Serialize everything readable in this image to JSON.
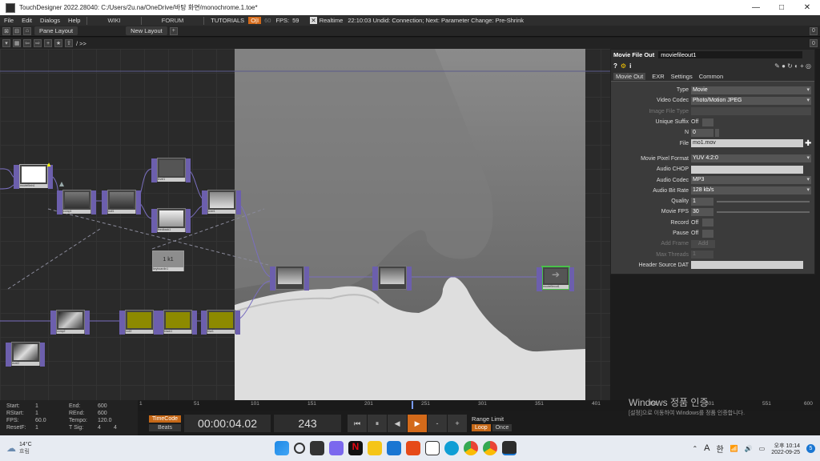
{
  "window": {
    "title": "TouchDesigner 2022.28040: C:/Users/2u.na/OneDrive/바탕 화면/monochrome.1.toe*",
    "controls": [
      "—",
      "□",
      "✕"
    ]
  },
  "menubar": {
    "items": [
      "File",
      "Edit",
      "Dialogs",
      "Help"
    ],
    "wiki": "WIKI",
    "forum": "FORUM",
    "tutorials": "TUTORIALS",
    "perf": "O|I",
    "fps_target": "60",
    "fps_label": "FPS:",
    "fps_value": "59",
    "realtime_check": "✕",
    "realtime_label": "Realtime",
    "status": "22:10:03 Undid: Connection; Next: Parameter Change: Pre-Shrink"
  },
  "panebar": {
    "pane_layout": "Pane Layout",
    "new_layout": "New Layout",
    "plus": "+",
    "pane_num": "0"
  },
  "pathbar": {
    "path": "/ >>"
  },
  "network": {
    "keyboard_label": "1 k1",
    "nodes": [
      "moviefilein1",
      "comp1",
      "null1",
      "level1",
      "feedback1",
      "over1",
      "keyboardin1",
      "comp2",
      "level2",
      "null2",
      "black1",
      "blur1",
      "moviefileout1"
    ]
  },
  "params": {
    "op_type": "Movie File Out",
    "op_name": "moviefileout1",
    "tabs": [
      "Movie Out",
      "EXR",
      "Settings",
      "Common"
    ],
    "rows": [
      {
        "label": "Type",
        "value": "Movie"
      },
      {
        "label": "Video Codec",
        "value": "Photo/Motion JPEG"
      },
      {
        "label": "Image File Type",
        "value": ""
      },
      {
        "label": "Unique Suffix",
        "value": "Off"
      },
      {
        "label": "N",
        "value": "0"
      },
      {
        "label": "File",
        "value": "mo1.mov"
      },
      {
        "label": "Movie Pixel Format",
        "value": "YUV 4:2:0"
      },
      {
        "label": "Audio CHOP",
        "value": ""
      },
      {
        "label": "Audio Codec",
        "value": "MP3"
      },
      {
        "label": "Audio Bit Rate",
        "value": "128 kb/s"
      },
      {
        "label": "Quality",
        "value": "1"
      },
      {
        "label": "Movie FPS",
        "value": "30"
      },
      {
        "label": "Record",
        "value": "Off"
      },
      {
        "label": "Pause",
        "value": "Off"
      },
      {
        "label": "Add Frame",
        "value": "Add"
      },
      {
        "label": "Max Threads",
        "value": "1"
      },
      {
        "label": "Header Source DAT",
        "value": ""
      }
    ]
  },
  "range": {
    "start_label": "Start:",
    "start": "1",
    "end_label": "End:",
    "end": "600",
    "rstart_label": "RStart:",
    "rstart": "1",
    "rend_label": "REnd:",
    "rend": "600",
    "fps_label": "FPS:",
    "fps": "60.0",
    "tempo_label": "Tempo:",
    "tempo": "120.0",
    "resetf_label": "ResetF:",
    "resetf": "1",
    "tsig_label": "T Sig:",
    "tsig_a": "4",
    "tsig_b": "4"
  },
  "timeline": {
    "ticks": [
      "1",
      "51",
      "101",
      "151",
      "201",
      "251",
      "301",
      "351",
      "401",
      "451",
      "501",
      "551",
      "600"
    ]
  },
  "transport": {
    "timecode_btn": "TimeCode",
    "beats_btn": "Beats",
    "timecode": "00:00:04.02",
    "frame": "243",
    "buttons": [
      "⏮",
      "⏸",
      "◀",
      "▶",
      "-",
      "+"
    ],
    "range_limit": "Range Limit",
    "loop": "Loop",
    "once": "Once"
  },
  "watermark": {
    "line1": "Windows 정품 인증",
    "line2": "[설정]으로 이동하여 Windows를 정품 인증합니다."
  },
  "taskbar": {
    "temp": "14°C",
    "weather": "흐림",
    "lang_a": "A",
    "lang_b": "한",
    "time": "오후 10:14",
    "date": "2022-09-25",
    "notif": "5"
  }
}
